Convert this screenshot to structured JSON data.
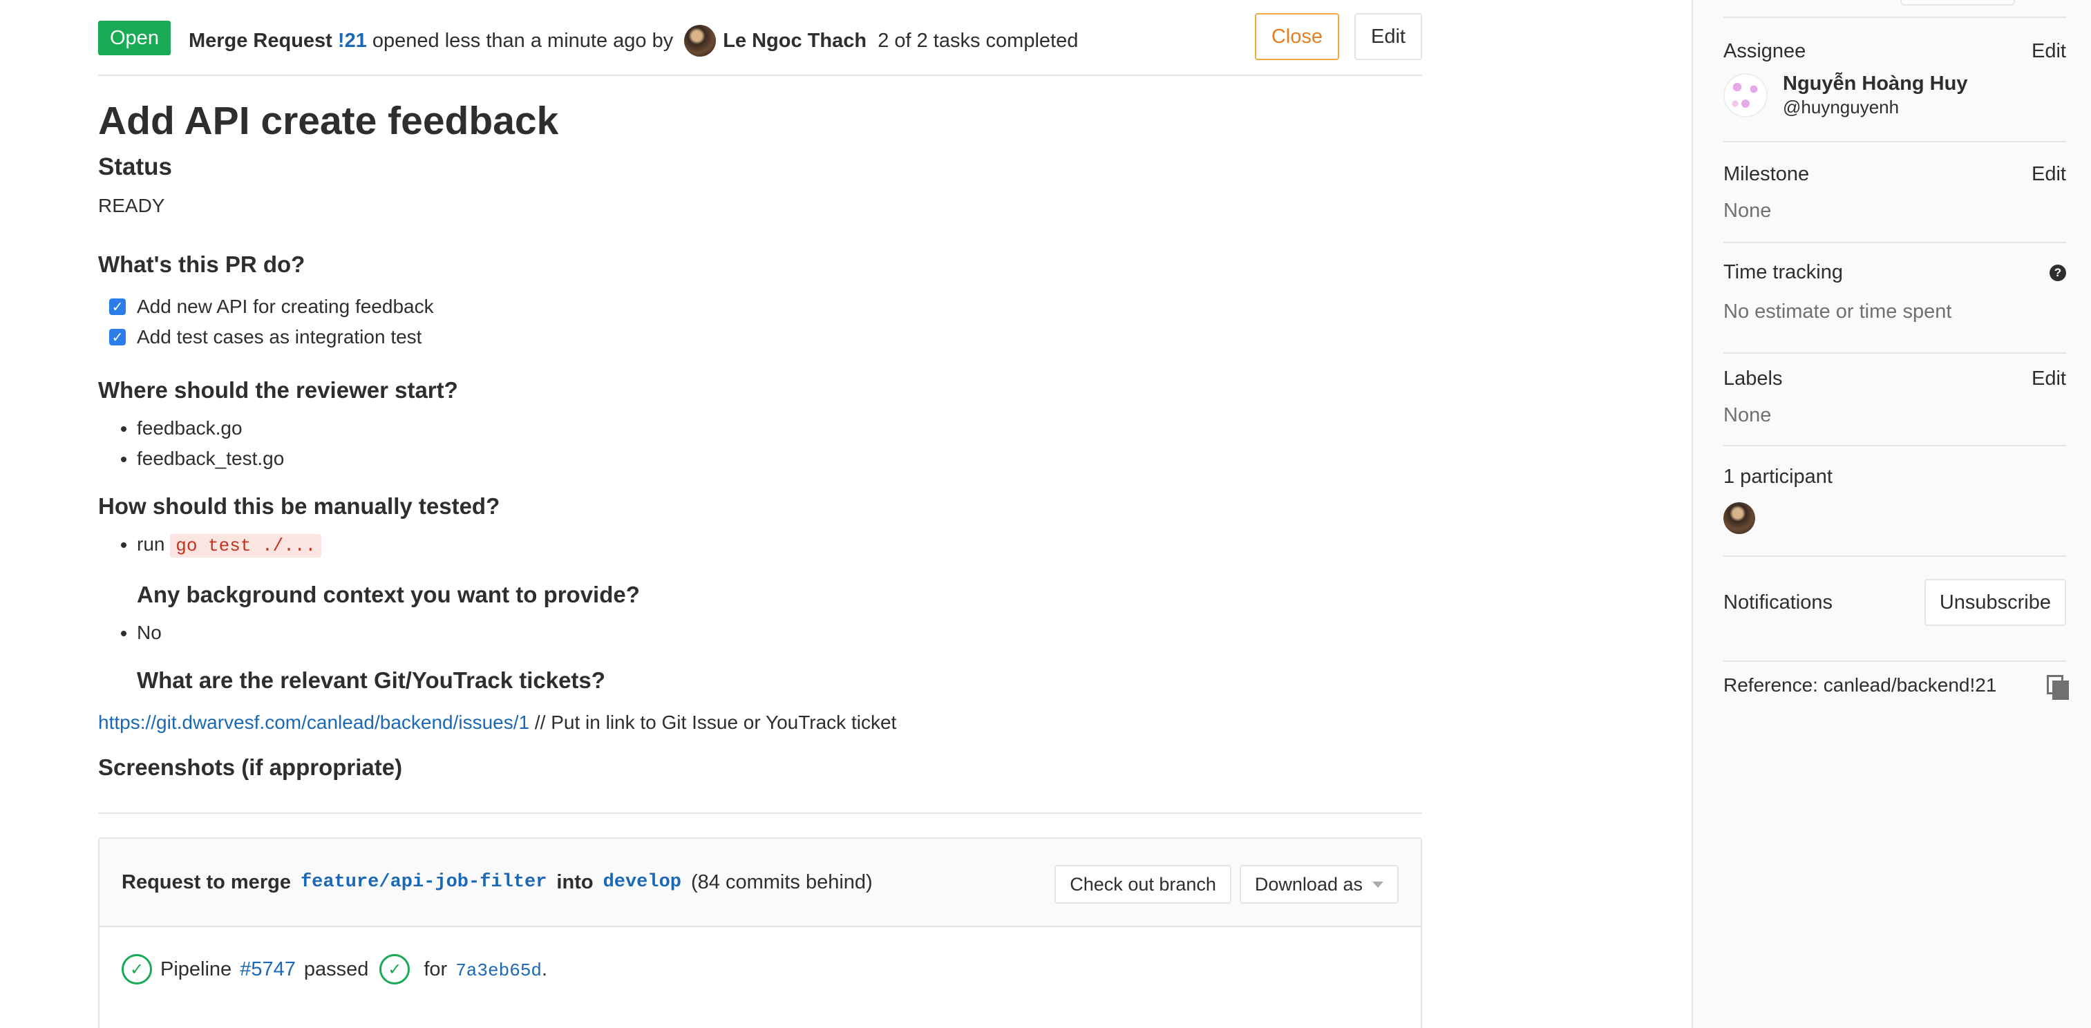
{
  "header": {
    "status": "Open",
    "merge_request_label": "Merge Request",
    "mr_ref": "!21",
    "opened_text": "opened less than a minute ago by",
    "author": "Le Ngoc Thach",
    "tasks_text": "2 of 2 tasks completed",
    "close_label": "Close",
    "edit_label": "Edit"
  },
  "description": {
    "title": "Add API create feedback",
    "status_heading": "Status",
    "status_value": "READY",
    "what_heading": "What's this PR do?",
    "tasks": [
      {
        "label": "Add new API for creating feedback",
        "checked": true
      },
      {
        "label": "Add test cases as integration test",
        "checked": true
      }
    ],
    "reviewer_heading": "Where should the reviewer start?",
    "reviewer_items": [
      "feedback.go",
      "feedback_test.go"
    ],
    "manual_heading": "How should this be manually tested?",
    "manual_prefix": "run",
    "manual_code": "go test ./...",
    "background_heading": "Any background context you want to provide?",
    "background_items": [
      "No"
    ],
    "tickets_heading": "What are the relevant Git/YouTrack tickets?",
    "ticket_url": "https://git.dwarvesf.com/canlead/backend/issues/1",
    "ticket_note": " // Put in link to Git Issue or YouTrack ticket",
    "screenshots_heading": "Screenshots (if appropriate)"
  },
  "merge_widget": {
    "request_label": "Request to merge",
    "source_branch": "feature/api-job-filter",
    "into_label": "into",
    "target_branch": "develop",
    "behind_text": "(84 commits behind)",
    "checkout_label": "Check out branch",
    "download_label": "Download as",
    "pipeline_label": "Pipeline",
    "pipeline_id": "#5747",
    "pipeline_status": "passed",
    "for_label": "for",
    "commit_sha": "7a3eb65d",
    "period": "."
  },
  "sidebar": {
    "assignee_label": "Assignee",
    "assignee_edit": "Edit",
    "assignee_name": "Nguyễn Hoàng Huy",
    "assignee_username": "@huynguyenh",
    "milestone_label": "Milestone",
    "milestone_edit": "Edit",
    "milestone_value": "None",
    "time_tracking_label": "Time tracking",
    "time_tracking_value": "No estimate or time spent",
    "labels_label": "Labels",
    "labels_edit": "Edit",
    "labels_value": "None",
    "participants_label": "1 participant",
    "notifications_label": "Notifications",
    "unsubscribe_label": "Unsubscribe",
    "reference_text": "Reference: canlead/backend!21"
  },
  "colors": {
    "open_badge": "#1aaa55",
    "link": "#1b69b6",
    "close_button": "#e67e22",
    "pipeline_success": "#1aaa55",
    "inline_code": "#c0341d"
  }
}
